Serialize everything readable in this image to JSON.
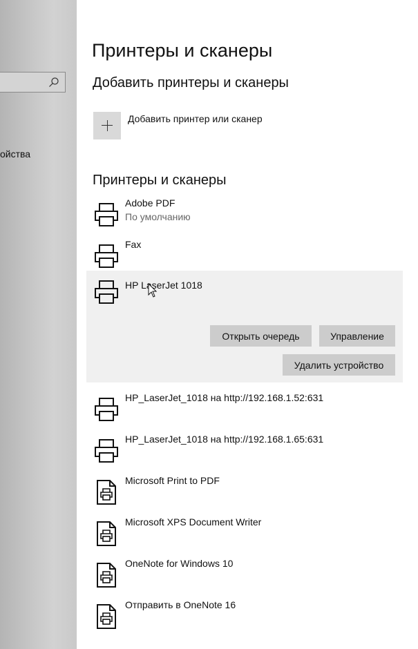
{
  "sidebar": {
    "search_placeholder": "",
    "item_label": "ойства"
  },
  "page": {
    "title": "Принтеры и сканеры"
  },
  "add_section": {
    "title": "Добавить принтеры и сканеры",
    "add_label": "Добавить принтер или сканер"
  },
  "devices_section": {
    "title": "Принтеры и сканеры"
  },
  "devices": [
    {
      "name": "Adobe PDF",
      "status": "По умолчанию",
      "icon": "printer-icon"
    },
    {
      "name": "Fax",
      "status": "",
      "icon": "printer-icon"
    },
    {
      "name": "HP LaserJet 1018",
      "status": "",
      "icon": "printer-icon"
    },
    {
      "name": "HP_LaserJet_1018 на http://192.168.1.52:631",
      "status": "",
      "icon": "printer-icon"
    },
    {
      "name": "HP_LaserJet_1018 на http://192.168.1.65:631",
      "status": "",
      "icon": "printer-icon"
    },
    {
      "name": "Microsoft Print to PDF",
      "status": "",
      "icon": "document-printer-icon"
    },
    {
      "name": "Microsoft XPS Document Writer",
      "status": "",
      "icon": "document-printer-icon"
    },
    {
      "name": "OneNote for Windows 10",
      "status": "",
      "icon": "document-printer-icon"
    },
    {
      "name": "Отправить в OneNote 16",
      "status": "",
      "icon": "document-printer-icon"
    }
  ],
  "selected_actions": {
    "open_queue": "Открыть очередь",
    "manage": "Управление",
    "remove": "Удалить устройство"
  }
}
